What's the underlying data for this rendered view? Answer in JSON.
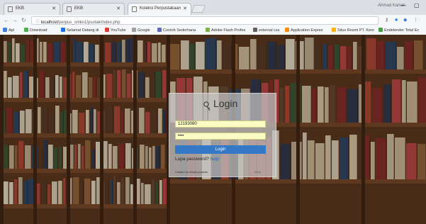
{
  "browser": {
    "tabs": [
      {
        "label": "EKB",
        "active": false
      },
      {
        "label": "EKB",
        "active": false
      },
      {
        "label": "Koleksi Perpustakaan",
        "active": true
      }
    ],
    "profile": "Ahmad Kamal",
    "url": {
      "host": "localhost",
      "path": "/perpus_smkn1/pustak/index.php"
    }
  },
  "bookmarks": [
    {
      "label": "Apl",
      "color": "#3c7fe0"
    },
    {
      "label": "Download",
      "color": "#4caf50"
    },
    {
      "label": "Selamat Datang di",
      "color": "#1a73e8"
    },
    {
      "label": "YouTube",
      "color": "#e53935"
    },
    {
      "label": "Google",
      "color": "#9e9e9e"
    },
    {
      "label": "Contoh Sederhana",
      "color": "#5c6bc0"
    },
    {
      "label": "Adobe Flash Profes",
      "color": "#7cb342"
    },
    {
      "label": "external css",
      "color": "#616161"
    },
    {
      "label": "Application Expres",
      "color": "#fb8c00"
    },
    {
      "label": "Situs Resmi PT. Kere",
      "color": "#ffb300"
    },
    {
      "label": "Endelender Total Ec",
      "color": "#43a047"
    }
  ],
  "login": {
    "title": "Login",
    "username": "12193080",
    "password": "••••",
    "button": "Login",
    "forgot_text": "Lupa password?",
    "forgot_link": "help",
    "footer": "Created by ahmad prasetia",
    "footer_right": "2018"
  }
}
